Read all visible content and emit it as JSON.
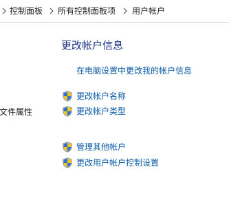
{
  "breadcrumb": {
    "items": [
      "控制面板",
      "所有控制面板项",
      "用户帐户"
    ]
  },
  "left_panel": {
    "partial_item": "文件属性"
  },
  "main": {
    "title": "更改帐户信息",
    "pc_settings_link": "在电脑设置中更改我的帐户信息",
    "tasks": [
      {
        "label": "更改帐户名称",
        "icon": "uac-shield-icon"
      },
      {
        "label": "更改帐户类型",
        "icon": "uac-shield-icon"
      },
      {
        "label": "管理其他帐户",
        "icon": "uac-shield-icon"
      },
      {
        "label": "更改用户帐户控制设置",
        "icon": "uac-shield-icon"
      }
    ]
  },
  "colors": {
    "title": "#1e3287",
    "link": "#0a5aa6",
    "text": "#1e1e1e"
  }
}
